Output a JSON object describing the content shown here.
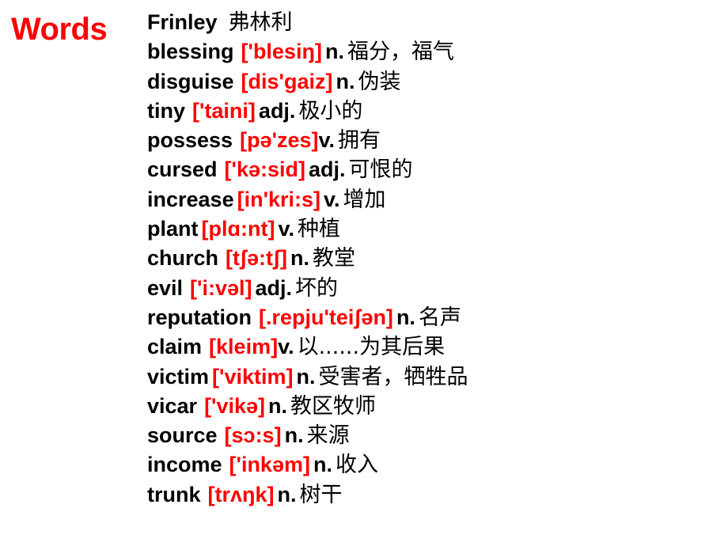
{
  "slide": {
    "title": "Words",
    "title_color": "#ff0000",
    "term_color": "#000000",
    "ipa_color": "#ff0000",
    "background_color": "#ffffff"
  },
  "entries": [
    {
      "term": "Frinley",
      "ipa": "",
      "pos": "",
      "gloss": "弗林利",
      "term_gap": "lg",
      "ipa_gap": "none"
    },
    {
      "term": "blessing",
      "ipa": "['blesiŋ]",
      "pos": "n.",
      "gloss": "福分，福气",
      "term_gap": "md",
      "ipa_gap": "sm"
    },
    {
      "term": "disguise",
      "ipa": "[dis'gaiz]",
      "pos": "n.",
      "gloss": "伪装",
      "term_gap": "md",
      "ipa_gap": "sm"
    },
    {
      "term": "tiny",
      "ipa": "['taini]",
      "pos": "adj.",
      "gloss": "极小的",
      "term_gap": "md",
      "ipa_gap": "sm"
    },
    {
      "term": "possess",
      "ipa": "[pə'zes]",
      "pos": "v.",
      "gloss": "拥有",
      "term_gap": "md",
      "ipa_gap": "none"
    },
    {
      "term": "cursed",
      "ipa": "['kə:sid]",
      "pos": "adj.",
      "gloss": "可恨的",
      "term_gap": "md",
      "ipa_gap": "sm"
    },
    {
      "term": "increase",
      "ipa": "[in'kri:s]",
      "pos": "v.",
      "gloss": "增加",
      "term_gap": "sm",
      "ipa_gap": "sm"
    },
    {
      "term": "plant",
      "ipa": "[plɑ:nt]",
      "pos": "v.",
      "gloss": "种植",
      "term_gap": "sm",
      "ipa_gap": "sm"
    },
    {
      "term": "church",
      "ipa": "[tʃə:tʃ]",
      "pos": "n.",
      "gloss": "教堂",
      "term_gap": "md",
      "ipa_gap": "sm"
    },
    {
      "term": "evil",
      "ipa": "['i:vəl]",
      "pos": "adj.",
      "gloss": "坏的",
      "term_gap": "md",
      "ipa_gap": "sm"
    },
    {
      "term": "reputation",
      "ipa": "[.repju'teiʃən]",
      "pos": "n.",
      "gloss": "名声",
      "term_gap": "md",
      "ipa_gap": "sm"
    },
    {
      "term": "claim",
      "ipa": "[kleim]",
      "pos": "v.",
      "gloss": "以......为其后果",
      "term_gap": "md",
      "ipa_gap": "none"
    },
    {
      "term": "victim",
      "ipa": "['viktim]",
      "pos": "n.",
      "gloss": "受害者，牺牲品",
      "term_gap": "sm",
      "ipa_gap": "sm"
    },
    {
      "term": "vicar",
      "ipa": "['vikə]",
      "pos": "n.",
      "gloss": "教区牧师",
      "term_gap": "md",
      "ipa_gap": "sm"
    },
    {
      "term": "source",
      "ipa": "[sɔ:s]",
      "pos": "n.",
      "gloss": "来源",
      "term_gap": "md",
      "ipa_gap": "sm"
    },
    {
      "term": "income",
      "ipa": "['inkəm]",
      "pos": "n.",
      "gloss": "收入",
      "term_gap": "md",
      "ipa_gap": "sm"
    },
    {
      "term": "trunk",
      "ipa": "[trʌŋk]",
      "pos": "n.",
      "gloss": "树干",
      "term_gap": "md",
      "ipa_gap": "sm"
    }
  ]
}
